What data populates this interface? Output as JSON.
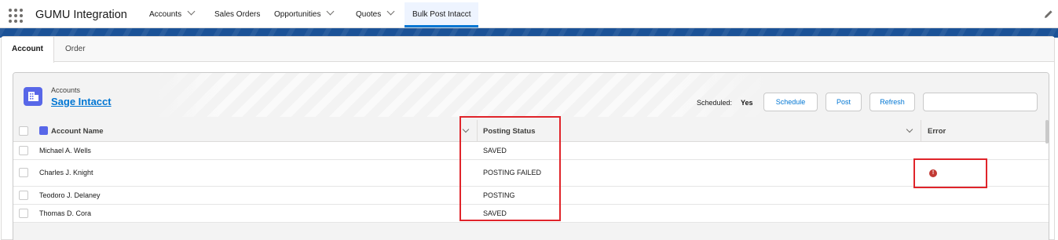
{
  "app": {
    "name": "GUMU Integration"
  },
  "nav": {
    "items": [
      {
        "label": "Accounts",
        "dropdown": true
      },
      {
        "label": "Sales Orders",
        "dropdown": false
      },
      {
        "label": "Opportunities",
        "dropdown": true
      },
      {
        "label": "Quotes",
        "dropdown": true
      },
      {
        "label": "Bulk Post Intacct",
        "dropdown": false,
        "active": true
      }
    ]
  },
  "tabs": [
    {
      "label": "Account",
      "active": true
    },
    {
      "label": "Order",
      "active": false
    }
  ],
  "list": {
    "object_label": "Accounts",
    "title": "Sage Intacct",
    "scheduled_label": "Scheduled:",
    "scheduled_value": "Yes",
    "buttons": {
      "schedule": "Schedule",
      "post": "Post",
      "refresh": "Refresh"
    },
    "search": {
      "value": "",
      "placeholder": ""
    },
    "columns": {
      "account_name": "Account Name",
      "posting_status": "Posting Status",
      "error": "Error"
    },
    "rows": [
      {
        "account_name": "Michael A. Wells",
        "posting_status": "SAVED",
        "error": false
      },
      {
        "account_name": "Charles J. Knight",
        "posting_status": "POSTING FAILED",
        "error": true,
        "error_icon": "!"
      },
      {
        "account_name": "Teodoro J. Delaney",
        "posting_status": "POSTING",
        "error": false
      },
      {
        "account_name": "Thomas D. Cora",
        "posting_status": "SAVED",
        "error": false
      }
    ]
  },
  "colors": {
    "brand_blue": "#1b5297",
    "accent": "#0176d3",
    "object_icon": "#5867e8",
    "error": "#c23934",
    "annotation_red": "#e0242a"
  },
  "icons": {
    "launcher": "app-launcher-icon",
    "edit": "pencil-icon",
    "object": "accounts-object-icon",
    "error": "error-icon"
  }
}
